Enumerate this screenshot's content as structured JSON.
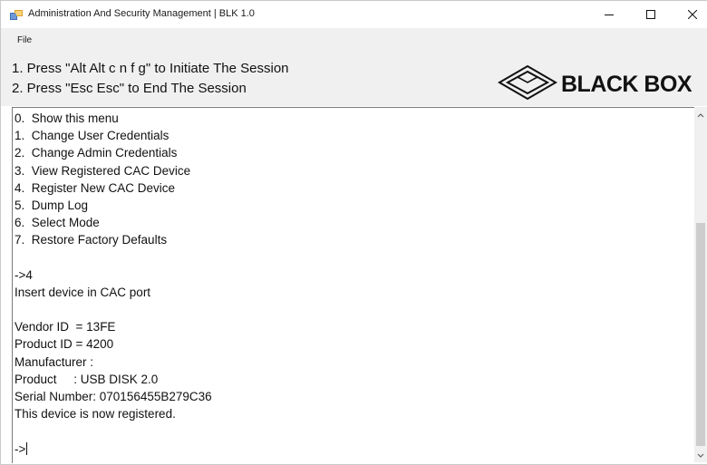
{
  "window": {
    "title": "Administration And Security Management  |  BLK 1.0",
    "controls": [
      "minimize-icon",
      "maximize-icon",
      "close-icon"
    ]
  },
  "menu": {
    "file": "File"
  },
  "instructions": {
    "line1": "1. Press \"Alt Alt c n f g\" to Initiate The Session",
    "line2": "2. Press \"Esc Esc\" to End The Session"
  },
  "brand": {
    "logo_text": "BLACK BOX"
  },
  "console": {
    "lines": [
      "0.  Show this menu",
      "1.  Change User Credentials",
      "2.  Change Admin Credentials",
      "3.  View Registered CAC Device",
      "4.  Register New CAC Device",
      "5.  Dump Log",
      "6.  Select Mode",
      "7.  Restore Factory Defaults",
      "",
      "->4",
      "Insert device in CAC port",
      "",
      "Vendor ID  = 13FE",
      "Product ID = 4200",
      "Manufacturer :",
      "Product     : USB DISK 2.0",
      "Serial Number: 070156455B279C36",
      "This device is now registered.",
      "",
      "->"
    ]
  },
  "colors": {
    "header_bg": "#f0f0f0",
    "console_bg": "#ffffff",
    "text": "#111111"
  }
}
